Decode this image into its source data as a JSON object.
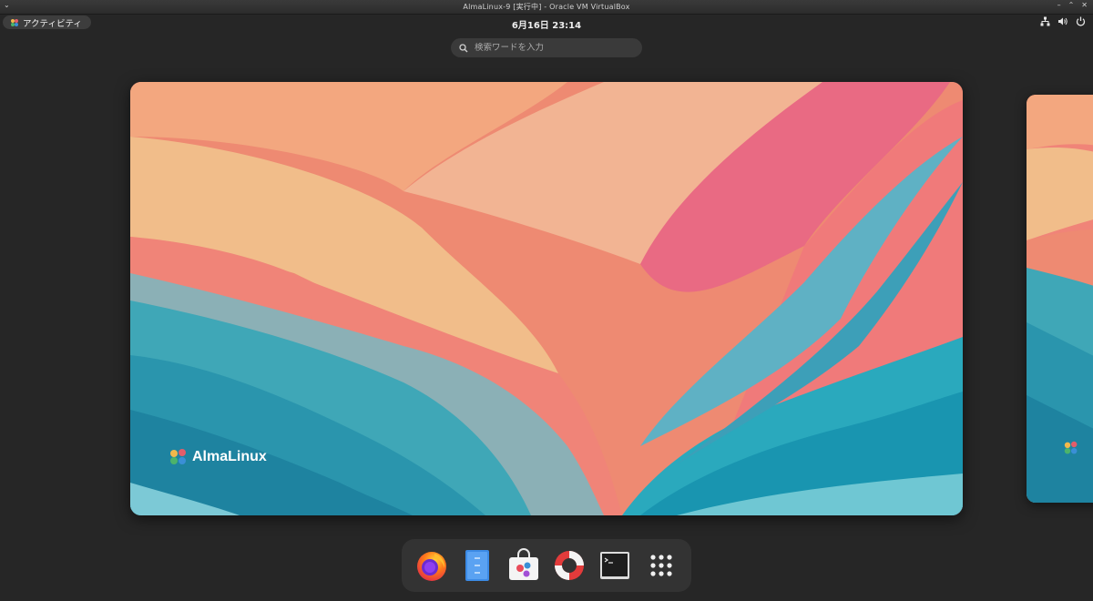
{
  "window": {
    "title": "AlmaLinux-9 [実行中] - Oracle VM VirtualBox",
    "menu_icon": "chevron-down-icon",
    "controls": [
      "minimize-icon",
      "restore-icon",
      "close-icon"
    ]
  },
  "topbar": {
    "activities_label": "アクティビティ",
    "clock": "6月16日  23:14",
    "tray_icons": [
      "network-icon",
      "volume-icon",
      "power-icon"
    ]
  },
  "search": {
    "placeholder": "検索ワードを入力",
    "value": ""
  },
  "workspace": {
    "brand": "AlmaLinux"
  },
  "dock": {
    "items": [
      {
        "name": "Firefox",
        "icon": "firefox-icon"
      },
      {
        "name": "Files",
        "icon": "files-icon"
      },
      {
        "name": "Software",
        "icon": "software-icon"
      },
      {
        "name": "Help",
        "icon": "help-icon"
      },
      {
        "name": "Terminal",
        "icon": "terminal-icon"
      },
      {
        "name": "Show Applications",
        "icon": "app-grid-icon"
      }
    ]
  },
  "colors": {
    "background": "#262626",
    "dock": "#333333",
    "search": "#3a3a3a"
  }
}
